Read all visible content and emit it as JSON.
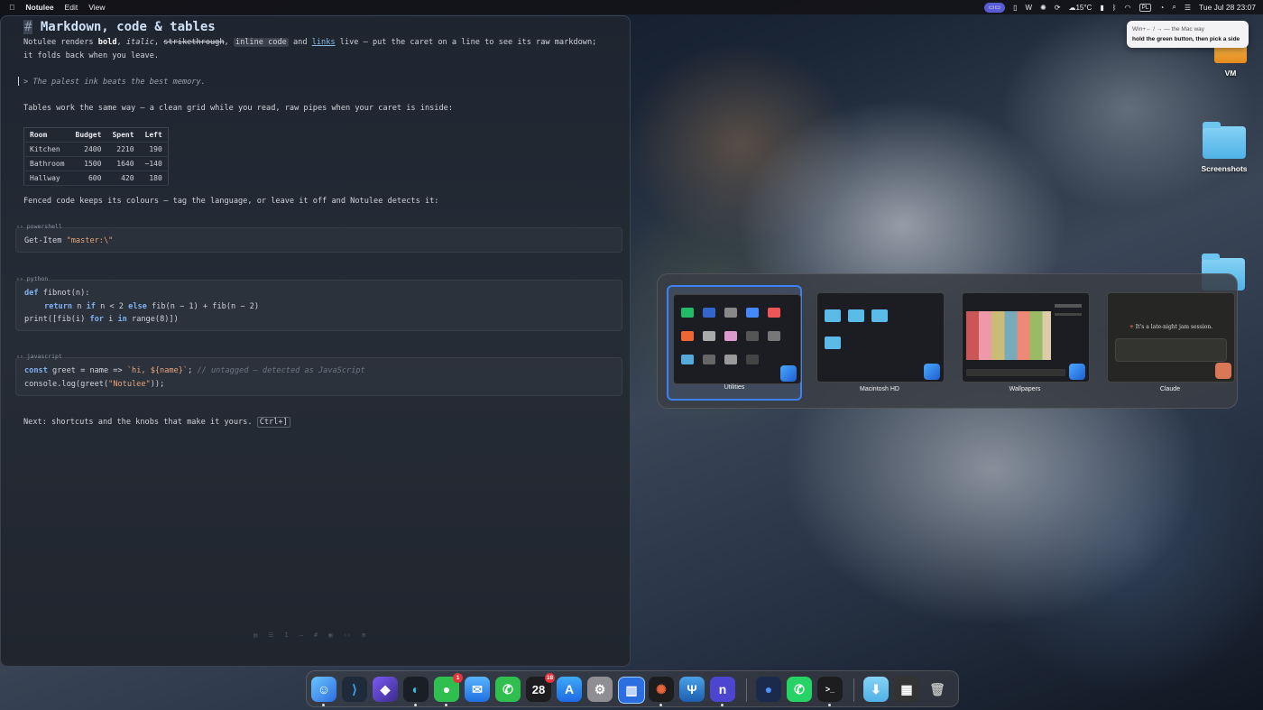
{
  "menubar": {
    "app_name": "Notulee",
    "menus": [
      "Edit",
      "View"
    ],
    "weather": "15°C",
    "input_source": "PL",
    "datetime": "Tue Jul 28  23:07"
  },
  "editor": {
    "heading": "Markdown, code & tables",
    "heading_hash": "#",
    "intro_pre": "Notulee renders ",
    "intro_bold": "bold",
    "intro_sep1": ", ",
    "intro_italic": "italic",
    "intro_sep2": ", ",
    "intro_strike": "strikethrough",
    "intro_sep3": ", ",
    "intro_code": "inline code",
    "intro_and": " and ",
    "intro_link": "links",
    "intro_post": " live — put the caret on a line to see its raw markdown; it folds back when you leave.",
    "quote": "> The palest ink beats the best memory.",
    "tables_intro": "Tables work the same way — a clean grid while you read, raw pipes when your caret is inside:",
    "table": {
      "headers": [
        "Room",
        "Budget",
        "Spent",
        "Left"
      ],
      "rows": [
        [
          "Kitchen",
          "2400",
          "2210",
          "190"
        ],
        [
          "Bathroom",
          "1500",
          "1640",
          "−140"
        ],
        [
          "Hallway",
          "600",
          "420",
          "180"
        ]
      ]
    },
    "fenced_intro": "Fenced code keeps its colours — tag the language, or leave it off and Notulee detects it:",
    "blocks": {
      "ps_lang": "‹› powershell",
      "ps_cmd": "Get-Item ",
      "ps_str": "\"master:\\\"",
      "py_lang": "‹› python",
      "py_def": "def",
      "py_l1": " fibnot(n):",
      "py_return": "return",
      "py_l2a": " n ",
      "py_if": "if",
      "py_l2b": " n < 2 ",
      "py_else": "else",
      "py_l2c": " fib(n − 1) + fib(n − 2)",
      "py_l3a": "print([fib(i) ",
      "py_for": "for",
      "py_l3b": " i ",
      "py_in": "in",
      "py_l3c": " range(8)])",
      "js_lang": "‹› javascript",
      "js_const": "const",
      "js_l1a": " greet = name => ",
      "js_str": "`hi, ${name}`",
      "js_l1b": ";   ",
      "js_comment": "// untagged — detected as JavaScript",
      "js_l2a": "console.log(greet(",
      "js_str2": "\"Notulee\"",
      "js_l2b": "));"
    },
    "next_line": "Next: shortcuts and the knobs that make it yours. ",
    "next_kbd": "Ctrl+]"
  },
  "desktop": {
    "icons": [
      "VM",
      "Screenshots"
    ]
  },
  "tooltip": {
    "line1": "Win+← / → — the Mac way",
    "line2": "hold the green button, then pick a side"
  },
  "switcher": {
    "items": [
      "Utilities",
      "Macintosh HD",
      "Wallpapers",
      "Claude"
    ],
    "claude_preview": "It's a late-night jam session."
  },
  "dock": {
    "calendar_day": "28",
    "calendar_badge": "18",
    "messages_badge": "1",
    "notulee_letter": "n",
    "terminal_glyph": ">_"
  }
}
